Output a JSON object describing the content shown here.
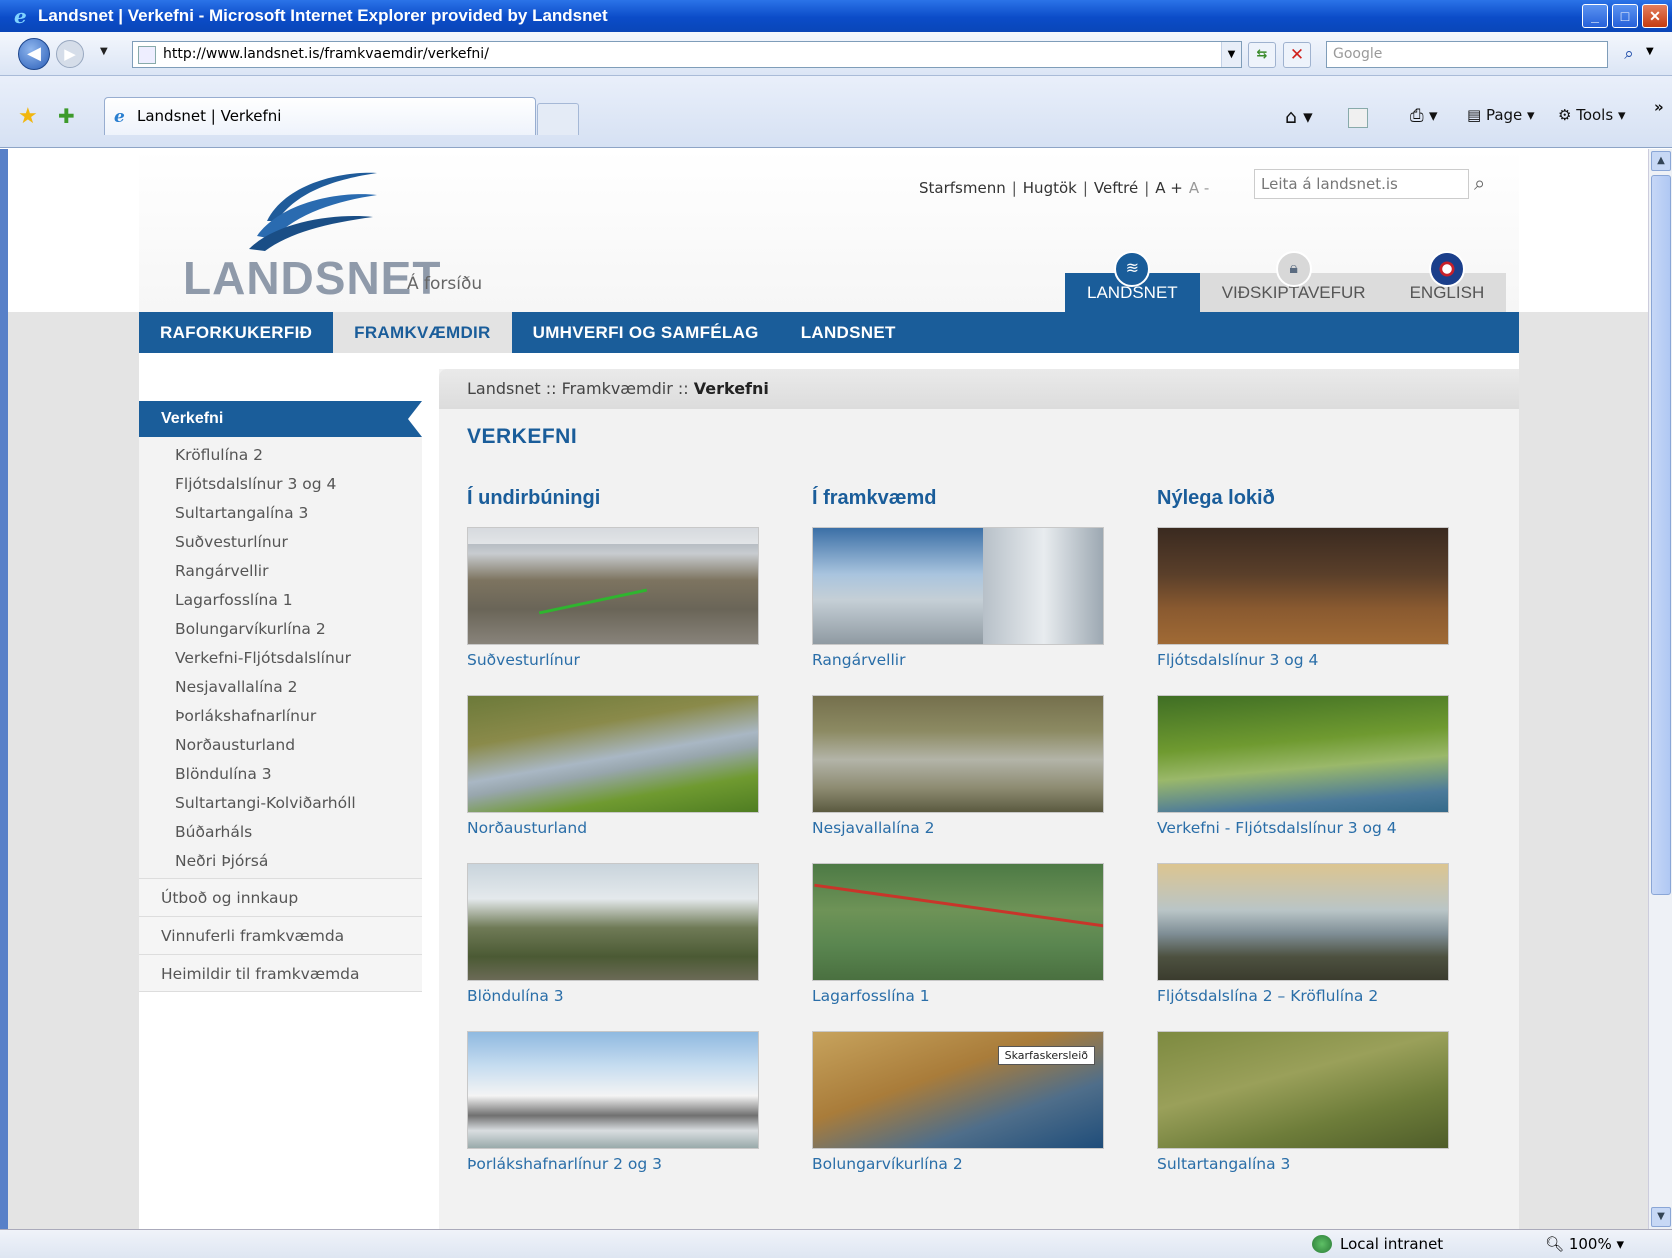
{
  "window": {
    "title": "Landsnet | Verkefni - Microsoft Internet Explorer provided by Landsnet",
    "min": "_",
    "max": "□",
    "close": "✕"
  },
  "browser": {
    "url": "http://www.landsnet.is/framkvaemdir/verkefni/",
    "search_placeholder": "Google",
    "tab_title": "Landsnet | Verkefni",
    "page_label": "Page",
    "tools_label": "Tools",
    "more": "»"
  },
  "site": {
    "logo_text": "LANDSNET",
    "home_link": "Á forsíðu",
    "util_links": [
      "Starfsmenn",
      "Hugtök",
      "Veftré",
      "A +",
      "A -"
    ],
    "search_placeholder": "Leita á landsnet.is",
    "top_tabs": [
      {
        "label": "LANDSNET",
        "icon": "wing-icon",
        "active": true
      },
      {
        "label": "VIÐSKIPTAVEFUR",
        "icon": "lock-icon",
        "active": false
      },
      {
        "label": "ENGLISH",
        "icon": "uk-flag-icon",
        "active": false
      }
    ],
    "main_nav": [
      {
        "label": "RAFORKUKERFIÐ",
        "active": false
      },
      {
        "label": "FRAMKVÆMDIR",
        "active": true
      },
      {
        "label": "UMHVERFI OG SAMFÉLAG",
        "active": false
      },
      {
        "label": "LANDSNET",
        "active": false
      }
    ]
  },
  "sidebar": {
    "heading": "Verkefni",
    "items": [
      "Kröflulína 2",
      "Fljótsdalslínur 3 og 4",
      "Sultartangalína 3",
      "Suðvesturlínur",
      "Rangárvellir",
      "Lagarfosslína 1",
      "Bolungarvíkurlína 2",
      "Verkefni-Fljótsdalslínur",
      "Nesjavallalína 2",
      "Þorlákshafnarlínur",
      "Norðausturland",
      "Blöndulína 3",
      "Sultartangi-Kolviðarhóll",
      "Búðarháls",
      "Neðri Þjórsá"
    ],
    "sections": [
      "Útboð og innkaup",
      "Vinnuferli framkvæmda",
      "Heimildir til framkvæmda"
    ]
  },
  "content": {
    "breadcrumb": {
      "a": "Landsnet",
      "sep": " :: ",
      "b": "Framkvæmdir",
      "current": "Verkefni"
    },
    "title": "VERKEFNI",
    "columns": [
      {
        "heading": "Í undirbúningi",
        "items": [
          "Suðvesturlínur",
          "Norðausturland",
          "Blöndulína 3",
          "Þorlákshafnarlínur 2 og 3"
        ]
      },
      {
        "heading": "Í framkvæmd",
        "items": [
          "Rangárvellir",
          "Nesjavallalína 2",
          "Lagarfosslína 1",
          "Bolungarvíkurlína 2"
        ]
      },
      {
        "heading": "Nýlega lokið",
        "items": [
          "Fljótsdalslínur 3 og 4",
          "Verkefni - Fljótsdalslínur 3 og 4",
          "Fljótsdalslína 2 – Kröflulína 2",
          "Sultartangalína 3"
        ]
      }
    ],
    "map_label": "Skarfaskersleið"
  },
  "status": {
    "zone": "Local intranet",
    "zoom": "100%"
  }
}
